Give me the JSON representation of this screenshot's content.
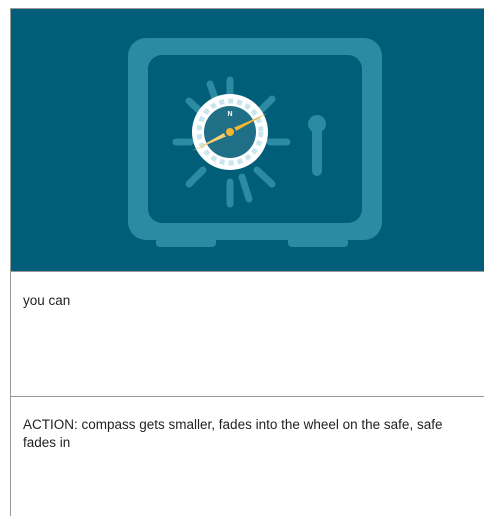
{
  "storyboard": {
    "frame_text": "you can",
    "action_note": "ACTION: compass gets smaller, fades into the wheel on the safe, safe fades in",
    "illustration": {
      "icon": "safe-with-compass-icon",
      "compass_letter": "N",
      "colors": {
        "background": "#005e78",
        "safe": "#2a8ba2",
        "compass_needle": "#f5b733",
        "compass_face": "#1f6f87",
        "compass_ring": "#ffffff"
      }
    }
  }
}
